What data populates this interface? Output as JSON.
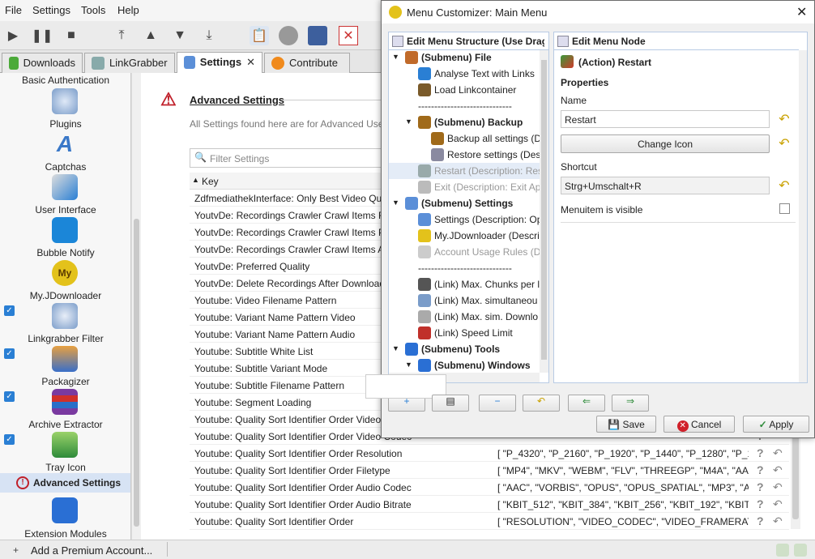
{
  "menubar": {
    "items": [
      "File",
      "Settings",
      "Tools",
      "Help"
    ]
  },
  "tabs": [
    {
      "label": "Downloads",
      "icon": "downloads-icon"
    },
    {
      "label": "LinkGrabber",
      "icon": "linkgrabber-icon"
    },
    {
      "label": "Settings",
      "icon": "wrench-icon"
    },
    {
      "label": "Contribute",
      "icon": "pumpkin-icon"
    }
  ],
  "sidebar": {
    "top_label": "Basic Authentication",
    "items": [
      {
        "label": "Plugins",
        "icon": "plugins-icon"
      },
      {
        "label": "Captchas",
        "icon": "captcha-icon"
      },
      {
        "label": "User Interface",
        "icon": "user-interface-icon"
      },
      {
        "label": "Bubble Notify",
        "icon": "bubble-icon"
      },
      {
        "label": "My.JDownloader",
        "icon": "myjd-icon"
      },
      {
        "label": "Linkgrabber Filter",
        "icon": "filter-icon"
      },
      {
        "label": "Packagizer",
        "icon": "packagizer-icon"
      },
      {
        "label": "Archive Extractor",
        "icon": "archive-icon"
      },
      {
        "label": "Tray Icon",
        "icon": "tray-icon"
      },
      {
        "label": "Advanced Settings",
        "icon": "warning-icon"
      },
      {
        "label": "Extension Modules",
        "icon": "puzzle-icon"
      }
    ]
  },
  "content": {
    "title": "Advanced Settings",
    "description": "All Settings found here are for Advanced Use",
    "filter_placeholder": "Filter Settings",
    "column_key": "Key",
    "rows": [
      {
        "key": "ZdfmediathekInterface: Only Best Video Quality",
        "value": ""
      },
      {
        "key": "YoutvDe: Recordings Crawler Crawl Items Re",
        "value": ""
      },
      {
        "key": "YoutvDe: Recordings Crawler Crawl Items Pr",
        "value": ""
      },
      {
        "key": "YoutvDe: Recordings Crawler Crawl Items A",
        "value": ""
      },
      {
        "key": "YoutvDe: Preferred Quality",
        "value": ""
      },
      {
        "key": "YoutvDe: Delete Recordings After Download",
        "value": ""
      },
      {
        "key": "Youtube: Video Filename Pattern",
        "value": ""
      },
      {
        "key": "Youtube: Variant Name Pattern Video",
        "value": ""
      },
      {
        "key": "Youtube: Variant Name Pattern Audio",
        "value": ""
      },
      {
        "key": "Youtube: Subtitle White List",
        "value": ""
      },
      {
        "key": "Youtube: Subtitle Variant Mode",
        "value": ""
      },
      {
        "key": "Youtube: Subtitle Filename Pattern",
        "value": ""
      },
      {
        "key": "Youtube: Segment Loading",
        "value": ""
      },
      {
        "key": "Youtube: Quality Sort Identifier Order Video",
        "value": ""
      },
      {
        "key": "Youtube: Quality Sort Identifier Order Video Codec",
        "value": ""
      },
      {
        "key": "Youtube: Quality Sort Identifier Order Resolution",
        "value": "[ \"P_4320\", \"P_2160\", \"P_1920\", \"P_1440\", \"P_1280\", \"P_108..."
      },
      {
        "key": "Youtube: Quality Sort Identifier Order Filetype",
        "value": "[ \"MP4\", \"MKV\", \"WEBM\", \"FLV\", \"THREEGP\", \"M4A\", \"AA..."
      },
      {
        "key": "Youtube: Quality Sort Identifier Order Audio Codec",
        "value": "[ \"AAC\", \"VORBIS\", \"OPUS\", \"OPUS_SPATIAL\", \"MP3\", \"A..."
      },
      {
        "key": "Youtube: Quality Sort Identifier Order Audio Bitrate",
        "value": "[ \"KBIT_512\", \"KBIT_384\", \"KBIT_256\", \"KBIT_192\", \"KBIT_16..."
      },
      {
        "key": "Youtube: Quality Sort Identifier Order",
        "value": "[ \"RESOLUTION\", \"VIDEO_CODEC\", \"VIDEO_FRAMERATE\", ..."
      }
    ]
  },
  "statusbar": {
    "premium": "Add a Premium Account..."
  },
  "dialog": {
    "title": "Menu Customizer: Main Menu",
    "left_header": "Edit Menu Structure (Use Drag",
    "right_header": "Edit Menu Node",
    "tree": [
      {
        "label": "(Submenu) File",
        "level": 0,
        "bold": true,
        "expand": "▼",
        "icon": "file-menu-icon",
        "disabled": false
      },
      {
        "label": "Analyse Text with Links",
        "level": 1,
        "bold": false,
        "expand": "",
        "icon": "plus-icon",
        "disabled": false
      },
      {
        "label": "Load Linkcontainer",
        "level": 1,
        "bold": false,
        "expand": "",
        "icon": "container-icon",
        "disabled": false
      },
      {
        "label": "-----------------------------",
        "level": 1,
        "bold": false,
        "expand": "",
        "icon": "",
        "disabled": false
      },
      {
        "label": "(Submenu) Backup",
        "level": 1,
        "bold": true,
        "expand": "▼",
        "icon": "backup-icon",
        "disabled": false
      },
      {
        "label": "Backup all settings (D",
        "level": 2,
        "bold": false,
        "expand": "",
        "icon": "backup-icon",
        "disabled": false
      },
      {
        "label": "Restore settings (Desc",
        "level": 2,
        "bold": false,
        "expand": "",
        "icon": "restore-icon",
        "disabled": false
      },
      {
        "label": "Restart (Description: Rest",
        "level": 1,
        "bold": false,
        "expand": "",
        "icon": "restart-icon",
        "disabled": true
      },
      {
        "label": "Exit (Description: Exit Ap",
        "level": 1,
        "bold": false,
        "expand": "",
        "icon": "exit-icon",
        "disabled": true
      },
      {
        "label": "(Submenu) Settings",
        "level": 0,
        "bold": true,
        "expand": "▼",
        "icon": "wrench-icon",
        "disabled": false
      },
      {
        "label": "Settings (Description: Op",
        "level": 1,
        "bold": false,
        "expand": "",
        "icon": "wrench-icon",
        "disabled": false
      },
      {
        "label": "My.JDownloader (Descri",
        "level": 1,
        "bold": false,
        "expand": "",
        "icon": "myjd-icon",
        "disabled": false
      },
      {
        "label": "Account Usage Rules (De",
        "level": 1,
        "bold": false,
        "expand": "",
        "icon": "account-icon",
        "disabled": true
      },
      {
        "label": "-----------------------------",
        "level": 1,
        "bold": false,
        "expand": "",
        "icon": "",
        "disabled": false
      },
      {
        "label": "(Link) Max. Chunks per l",
        "level": 1,
        "bold": false,
        "expand": "",
        "icon": "chunks-icon",
        "disabled": false
      },
      {
        "label": "(Link) Max. simultaneou",
        "level": 1,
        "bold": false,
        "expand": "",
        "icon": "simultaneous-icon",
        "disabled": false
      },
      {
        "label": "(Link) Max. sim. Downlo",
        "level": 1,
        "bold": false,
        "expand": "",
        "icon": "downloads-icon",
        "disabled": false
      },
      {
        "label": "(Link) Speed Limit",
        "level": 1,
        "bold": false,
        "expand": "",
        "icon": "speed-icon",
        "disabled": false
      },
      {
        "label": "(Submenu) Tools",
        "level": 0,
        "bold": true,
        "expand": "▼",
        "icon": "tools-icon",
        "disabled": false
      },
      {
        "label": "(Submenu) Windows",
        "level": 1,
        "bold": true,
        "expand": "▼",
        "icon": "windows-icon",
        "disabled": false
      }
    ],
    "node_title": "(Action) Restart",
    "properties_label": "Properties",
    "name_label": "Name",
    "name_value": "Restart",
    "change_icon": "Change Icon",
    "shortcut_label": "Shortcut",
    "shortcut_value": "Strg+Umschalt+R",
    "visible_label": "Menuitem is visible",
    "save": "Save",
    "cancel": "Cancel",
    "apply": "Apply"
  }
}
